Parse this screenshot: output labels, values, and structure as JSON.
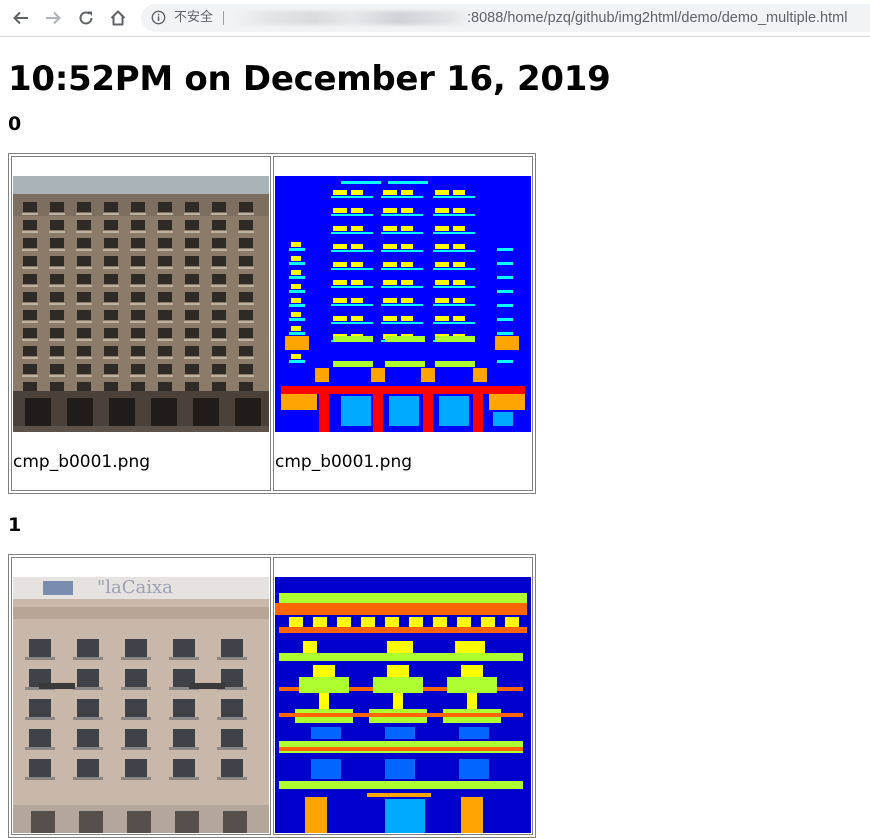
{
  "browser": {
    "security_label": "不安全",
    "url": ":8088/home/pzq/github/img2html/demo/demo_multiple.html"
  },
  "page": {
    "title": "10:52PM on December 16, 2019",
    "sections": [
      {
        "label": "0",
        "photo_caption": "cmp_b0001.png",
        "seg_caption": "cmp_b0001.png"
      },
      {
        "label": "1"
      }
    ]
  },
  "photo1_sign_text": "\"laCaixa",
  "colors": {
    "seg_background": "#0000ff",
    "seg_window": "#ffff00",
    "seg_sill": "#00ffff",
    "seg_balcony": "#adff2f",
    "seg_shop": "#ffa500",
    "seg_pillar": "#ff0000",
    "seg_door": "#00aaff",
    "seg_blind": "#0066ff"
  }
}
